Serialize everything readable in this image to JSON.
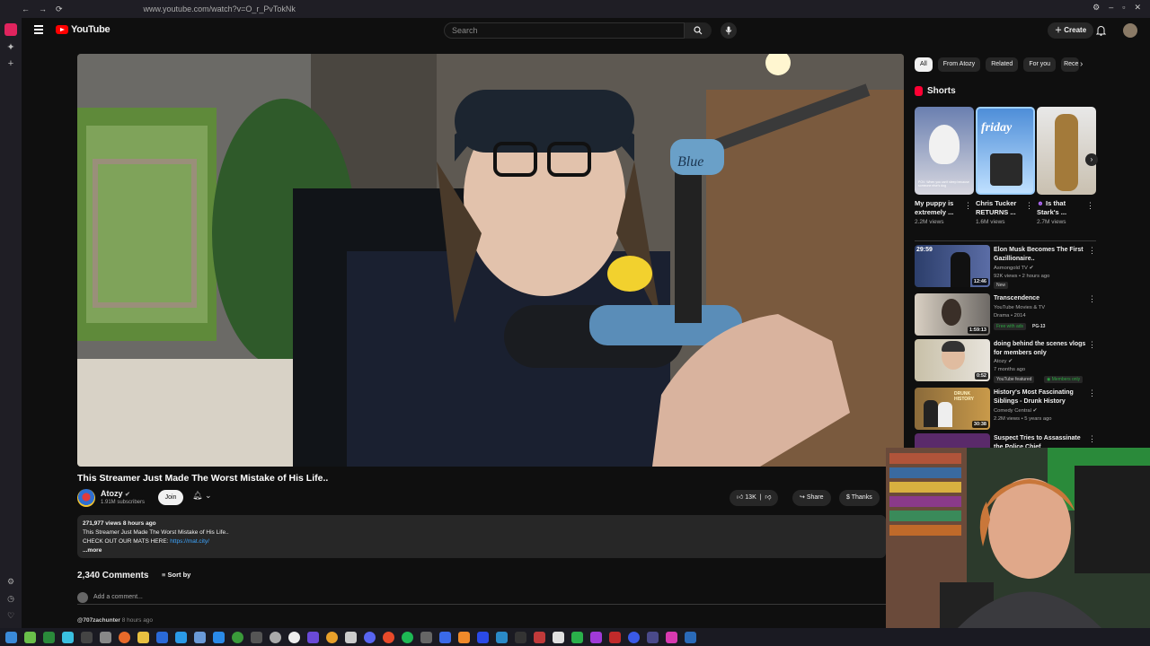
{
  "browser": {
    "url": "www.youtube.com/watch?v=O_r_PvTokNk"
  },
  "header": {
    "logo_text": "YouTube",
    "search_placeholder": "Search",
    "create_label": "Create"
  },
  "video": {
    "title": "This Streamer Just Made The Worst Mistake of His Life..",
    "channel_name": "Atozy",
    "subscribers": "1.91M subscribers",
    "join_label": "Join",
    "likes": "13K",
    "share_label": "Share",
    "thanks_label": "Thanks"
  },
  "description": {
    "stats": "271,977 views  8 hours ago",
    "line1": "This Streamer Just Made The Worst Mistake of His Life..",
    "line2_prefix": "CHECK OUT OUR MATS HERE: ",
    "link": "https://mat.city/",
    "more": "...more"
  },
  "comments": {
    "count_label": "2,340 Comments",
    "sort_label": "Sort by",
    "add_placeholder": "Add a comment...",
    "first_author": "@707zachunter",
    "first_time": "8 hours ago"
  },
  "chips": [
    "All",
    "From Atozy",
    "Related",
    "For you",
    "Rece"
  ],
  "shorts": {
    "header": "Shorts",
    "items": [
      {
        "title": "My puppy is extremely ...",
        "views": "2.2M views",
        "thumb_text": "POV: When you can't sleep because someone else's dog"
      },
      {
        "title": "Chris Tucker RETURNS ...",
        "views": "1.6M views",
        "thumb_text": "friday"
      },
      {
        "title": "Is that Stark's ...",
        "views": "2.7M views",
        "thumb_text": ""
      }
    ]
  },
  "recommendations": [
    {
      "title": "Elon Musk Becomes The First Gazillionaire..",
      "channel": "Asmongold TV",
      "meta": "92K views • 2 hours ago",
      "badge": "New",
      "badge2": "",
      "duration": "12:46",
      "overlay": "29:59"
    },
    {
      "title": "Transcendence",
      "channel": "YouTube Movies & TV",
      "meta": "Drama • 2014",
      "badge": "Free with ads",
      "badge2": "PG-13",
      "duration": "1:59:13",
      "overlay": ""
    },
    {
      "title": "doing behind the scenes vlogs for members only",
      "channel": "Atozy",
      "meta": "7 months ago",
      "badge": "YouTube featured",
      "badge2": "Members only",
      "duration": "0:52",
      "overlay": ""
    },
    {
      "title": "History's Most Fascinating Siblings - Drunk History",
      "channel": "Comedy Central",
      "meta": "2.2M views • 5 years ago",
      "badge": "",
      "badge2": "",
      "duration": "30:38",
      "overlay": "DRUNK HISTORY"
    },
    {
      "title": "Suspect Tries to Assassinate the Police Chief",
      "channel": "",
      "meta": "",
      "badge": "",
      "badge2": "",
      "duration": "",
      "overlay": ""
    }
  ],
  "video_overlay": {
    "mic_brand": "Blue"
  },
  "icons": [
    "menu-icon",
    "search-icon",
    "mic-icon",
    "bell-icon",
    "like-icon",
    "dislike-icon",
    "share-icon",
    "thanks-icon",
    "sort-icon",
    "kebab-icon",
    "chevron-right-icon"
  ],
  "colors": {
    "accent": "#ff0000",
    "link": "#3ea6ff",
    "background": "#0f0f0f",
    "surface": "#272727"
  }
}
